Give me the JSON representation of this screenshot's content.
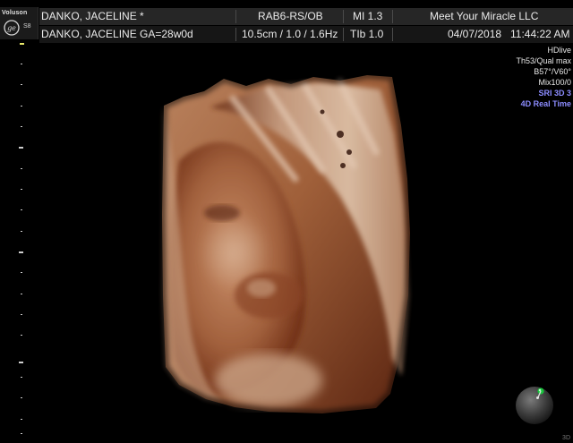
{
  "header": {
    "brand": "Voluson",
    "model": "S8",
    "row1": {
      "patient_name": "DANKO, JACELINE  *",
      "probe_mode": "RAB6-RS/OB",
      "mi": "MI  1.3",
      "institution": "Meet Your Miracle LLC"
    },
    "row2": {
      "patient_ga": "DANKO, JACELINE  GA=28w0d",
      "depth_freq": "10.5cm / 1.0 / 1.6Hz",
      "tib": "TIb  1.0",
      "date": "04/07/2018",
      "time": "11:44:22 AM"
    }
  },
  "info_panel": {
    "hdlive": "HDlive",
    "threshold": "Th53/Qual max",
    "angles": "B57°/V60°",
    "mix": "Mix100/0",
    "sri": "SRI 3D 3",
    "mode": "4D Real Time"
  },
  "corner_label": "3D",
  "colors": {
    "background": "#000000",
    "header_row1": "#262626",
    "header_row2": "#161616",
    "mode_text": "#8c8cff",
    "skin_light": "#d8b79c",
    "skin_dark": "#6a2c12",
    "orientation_marker": "#18c43c"
  },
  "icons": [
    "ge-logo-icon",
    "orientation-ball-icon"
  ]
}
